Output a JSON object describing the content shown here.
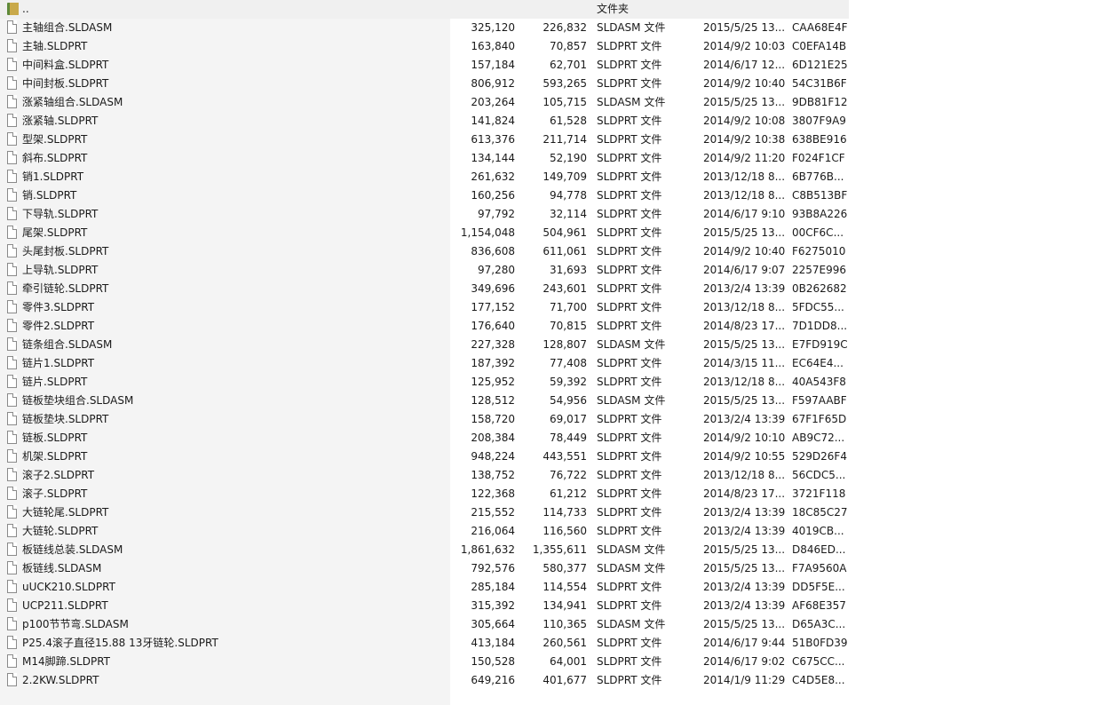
{
  "parent": {
    "name": "..",
    "type": "文件夹",
    "icon": "folder-icon"
  },
  "files": [
    {
      "name": "主轴组合.SLDASM",
      "size": "325,120",
      "packed": "226,832",
      "type": "SLDASM 文件",
      "modified": "2015/5/25 13...",
      "crc": "CAA68E4F"
    },
    {
      "name": "主轴.SLDPRT",
      "size": "163,840",
      "packed": "70,857",
      "type": "SLDPRT 文件",
      "modified": "2014/9/2 10:03",
      "crc": "C0EFA14B"
    },
    {
      "name": "中间料盒.SLDPRT",
      "size": "157,184",
      "packed": "62,701",
      "type": "SLDPRT 文件",
      "modified": "2014/6/17 12...",
      "crc": "6D121E25"
    },
    {
      "name": "中间封板.SLDPRT",
      "size": "806,912",
      "packed": "593,265",
      "type": "SLDPRT 文件",
      "modified": "2014/9/2 10:40",
      "crc": "54C31B6F"
    },
    {
      "name": "涨紧轴组合.SLDASM",
      "size": "203,264",
      "packed": "105,715",
      "type": "SLDASM 文件",
      "modified": "2015/5/25 13...",
      "crc": "9DB81F12"
    },
    {
      "name": "涨紧轴.SLDPRT",
      "size": "141,824",
      "packed": "61,528",
      "type": "SLDPRT 文件",
      "modified": "2014/9/2 10:08",
      "crc": "3807F9A9"
    },
    {
      "name": "型架.SLDPRT",
      "size": "613,376",
      "packed": "211,714",
      "type": "SLDPRT 文件",
      "modified": "2014/9/2 10:38",
      "crc": "638BE916"
    },
    {
      "name": "斜布.SLDPRT",
      "size": "134,144",
      "packed": "52,190",
      "type": "SLDPRT 文件",
      "modified": "2014/9/2 11:20",
      "crc": "F024F1CF"
    },
    {
      "name": "销1.SLDPRT",
      "size": "261,632",
      "packed": "149,709",
      "type": "SLDPRT 文件",
      "modified": "2013/12/18 8...",
      "crc": "6B776B..."
    },
    {
      "name": "销.SLDPRT",
      "size": "160,256",
      "packed": "94,778",
      "type": "SLDPRT 文件",
      "modified": "2013/12/18 8...",
      "crc": "C8B513BF"
    },
    {
      "name": "下导轨.SLDPRT",
      "size": "97,792",
      "packed": "32,114",
      "type": "SLDPRT 文件",
      "modified": "2014/6/17 9:10",
      "crc": "93B8A226"
    },
    {
      "name": "尾架.SLDPRT",
      "size": "1,154,048",
      "packed": "504,961",
      "type": "SLDPRT 文件",
      "modified": "2015/5/25 13...",
      "crc": "00CF6C..."
    },
    {
      "name": "头尾封板.SLDPRT",
      "size": "836,608",
      "packed": "611,061",
      "type": "SLDPRT 文件",
      "modified": "2014/9/2 10:40",
      "crc": "F6275010"
    },
    {
      "name": "上导轨.SLDPRT",
      "size": "97,280",
      "packed": "31,693",
      "type": "SLDPRT 文件",
      "modified": "2014/6/17 9:07",
      "crc": "2257E996"
    },
    {
      "name": "牵引链轮.SLDPRT",
      "size": "349,696",
      "packed": "243,601",
      "type": "SLDPRT 文件",
      "modified": "2013/2/4 13:39",
      "crc": "0B262682"
    },
    {
      "name": "零件3.SLDPRT",
      "size": "177,152",
      "packed": "71,700",
      "type": "SLDPRT 文件",
      "modified": "2013/12/18 8...",
      "crc": "5FDC55..."
    },
    {
      "name": "零件2.SLDPRT",
      "size": "176,640",
      "packed": "70,815",
      "type": "SLDPRT 文件",
      "modified": "2014/8/23 17...",
      "crc": "7D1DD8..."
    },
    {
      "name": "链条组合.SLDASM",
      "size": "227,328",
      "packed": "128,807",
      "type": "SLDASM 文件",
      "modified": "2015/5/25 13...",
      "crc": "E7FD919C"
    },
    {
      "name": "链片1.SLDPRT",
      "size": "187,392",
      "packed": "77,408",
      "type": "SLDPRT 文件",
      "modified": "2014/3/15 11...",
      "crc": "EC64E4..."
    },
    {
      "name": "链片.SLDPRT",
      "size": "125,952",
      "packed": "59,392",
      "type": "SLDPRT 文件",
      "modified": "2013/12/18 8...",
      "crc": "40A543F8"
    },
    {
      "name": "链板垫块组合.SLDASM",
      "size": "128,512",
      "packed": "54,956",
      "type": "SLDASM 文件",
      "modified": "2015/5/25 13...",
      "crc": "F597AABF"
    },
    {
      "name": "链板垫块.SLDPRT",
      "size": "158,720",
      "packed": "69,017",
      "type": "SLDPRT 文件",
      "modified": "2013/2/4 13:39",
      "crc": "67F1F65D"
    },
    {
      "name": "链板.SLDPRT",
      "size": "208,384",
      "packed": "78,449",
      "type": "SLDPRT 文件",
      "modified": "2014/9/2 10:10",
      "crc": "AB9C72..."
    },
    {
      "name": "机架.SLDPRT",
      "size": "948,224",
      "packed": "443,551",
      "type": "SLDPRT 文件",
      "modified": "2014/9/2 10:55",
      "crc": "529D26F4"
    },
    {
      "name": "滚子2.SLDPRT",
      "size": "138,752",
      "packed": "76,722",
      "type": "SLDPRT 文件",
      "modified": "2013/12/18 8...",
      "crc": "56CDC5..."
    },
    {
      "name": "滚子.SLDPRT",
      "size": "122,368",
      "packed": "61,212",
      "type": "SLDPRT 文件",
      "modified": "2014/8/23 17...",
      "crc": "3721F118"
    },
    {
      "name": "大链轮尾.SLDPRT",
      "size": "215,552",
      "packed": "114,733",
      "type": "SLDPRT 文件",
      "modified": "2013/2/4 13:39",
      "crc": "18C85C27"
    },
    {
      "name": "大链轮.SLDPRT",
      "size": "216,064",
      "packed": "116,560",
      "type": "SLDPRT 文件",
      "modified": "2013/2/4 13:39",
      "crc": "4019CB..."
    },
    {
      "name": "板链线总装.SLDASM",
      "size": "1,861,632",
      "packed": "1,355,611",
      "type": "SLDASM 文件",
      "modified": "2015/5/25 13...",
      "crc": "D846ED..."
    },
    {
      "name": "板链线.SLDASM",
      "size": "792,576",
      "packed": "580,377",
      "type": "SLDASM 文件",
      "modified": "2015/5/25 13...",
      "crc": "F7A9560A"
    },
    {
      "name": "uUCK210.SLDPRT",
      "size": "285,184",
      "packed": "114,554",
      "type": "SLDPRT 文件",
      "modified": "2013/2/4 13:39",
      "crc": "DD5F5E..."
    },
    {
      "name": "UCP211.SLDPRT",
      "size": "315,392",
      "packed": "134,941",
      "type": "SLDPRT 文件",
      "modified": "2013/2/4 13:39",
      "crc": "AF68E357"
    },
    {
      "name": "p100节节弯.SLDASM",
      "size": "305,664",
      "packed": "110,365",
      "type": "SLDASM 文件",
      "modified": "2015/5/25 13...",
      "crc": "D65A3C..."
    },
    {
      "name": "P25.4滚子直径15.88  13牙链轮.SLDPRT",
      "size": "413,184",
      "packed": "260,561",
      "type": "SLDPRT 文件",
      "modified": "2014/6/17 9:44",
      "crc": "51B0FD39"
    },
    {
      "name": "M14脚蹄.SLDPRT",
      "size": "150,528",
      "packed": "64,001",
      "type": "SLDPRT 文件",
      "modified": "2014/6/17 9:02",
      "crc": "C675CC..."
    },
    {
      "name": "2.2KW.SLDPRT",
      "size": "649,216",
      "packed": "401,677",
      "type": "SLDPRT 文件",
      "modified": "2014/1/9 11:29",
      "crc": "C4D5E8..."
    }
  ]
}
